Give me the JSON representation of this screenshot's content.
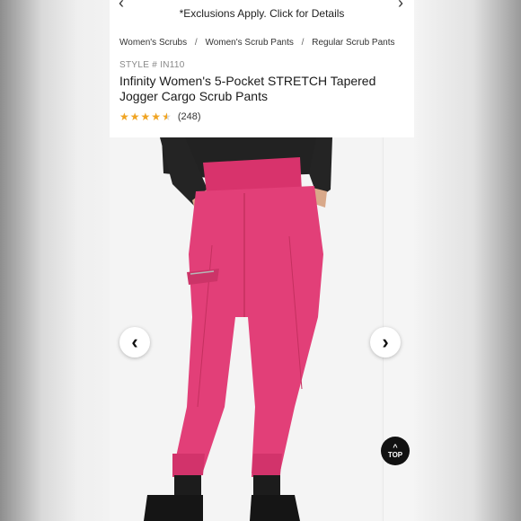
{
  "promo": {
    "text": "*Exclusions Apply. Click for Details",
    "prev_icon": "‹",
    "next_icon": "›"
  },
  "breadcrumb": [
    "Women's Scrubs",
    "Women's Scrub Pants",
    "Regular Scrub Pants"
  ],
  "breadcrumb_separator": "/",
  "product": {
    "style_code": "STYLE # IN110",
    "title": "Infinity Women's 5-Pocket STRETCH Tapered Jogger Cargo Scrub Pants",
    "rating": 4.5,
    "review_count": "(248)",
    "color": "#e23f78"
  },
  "gallery": {
    "prev_icon": "‹",
    "next_icon": "›"
  },
  "back_to_top": {
    "label": "TOP",
    "icon": "^"
  },
  "colors": {
    "star": "#f0a422",
    "pants": "#e23f78",
    "shirt": "#222222"
  }
}
